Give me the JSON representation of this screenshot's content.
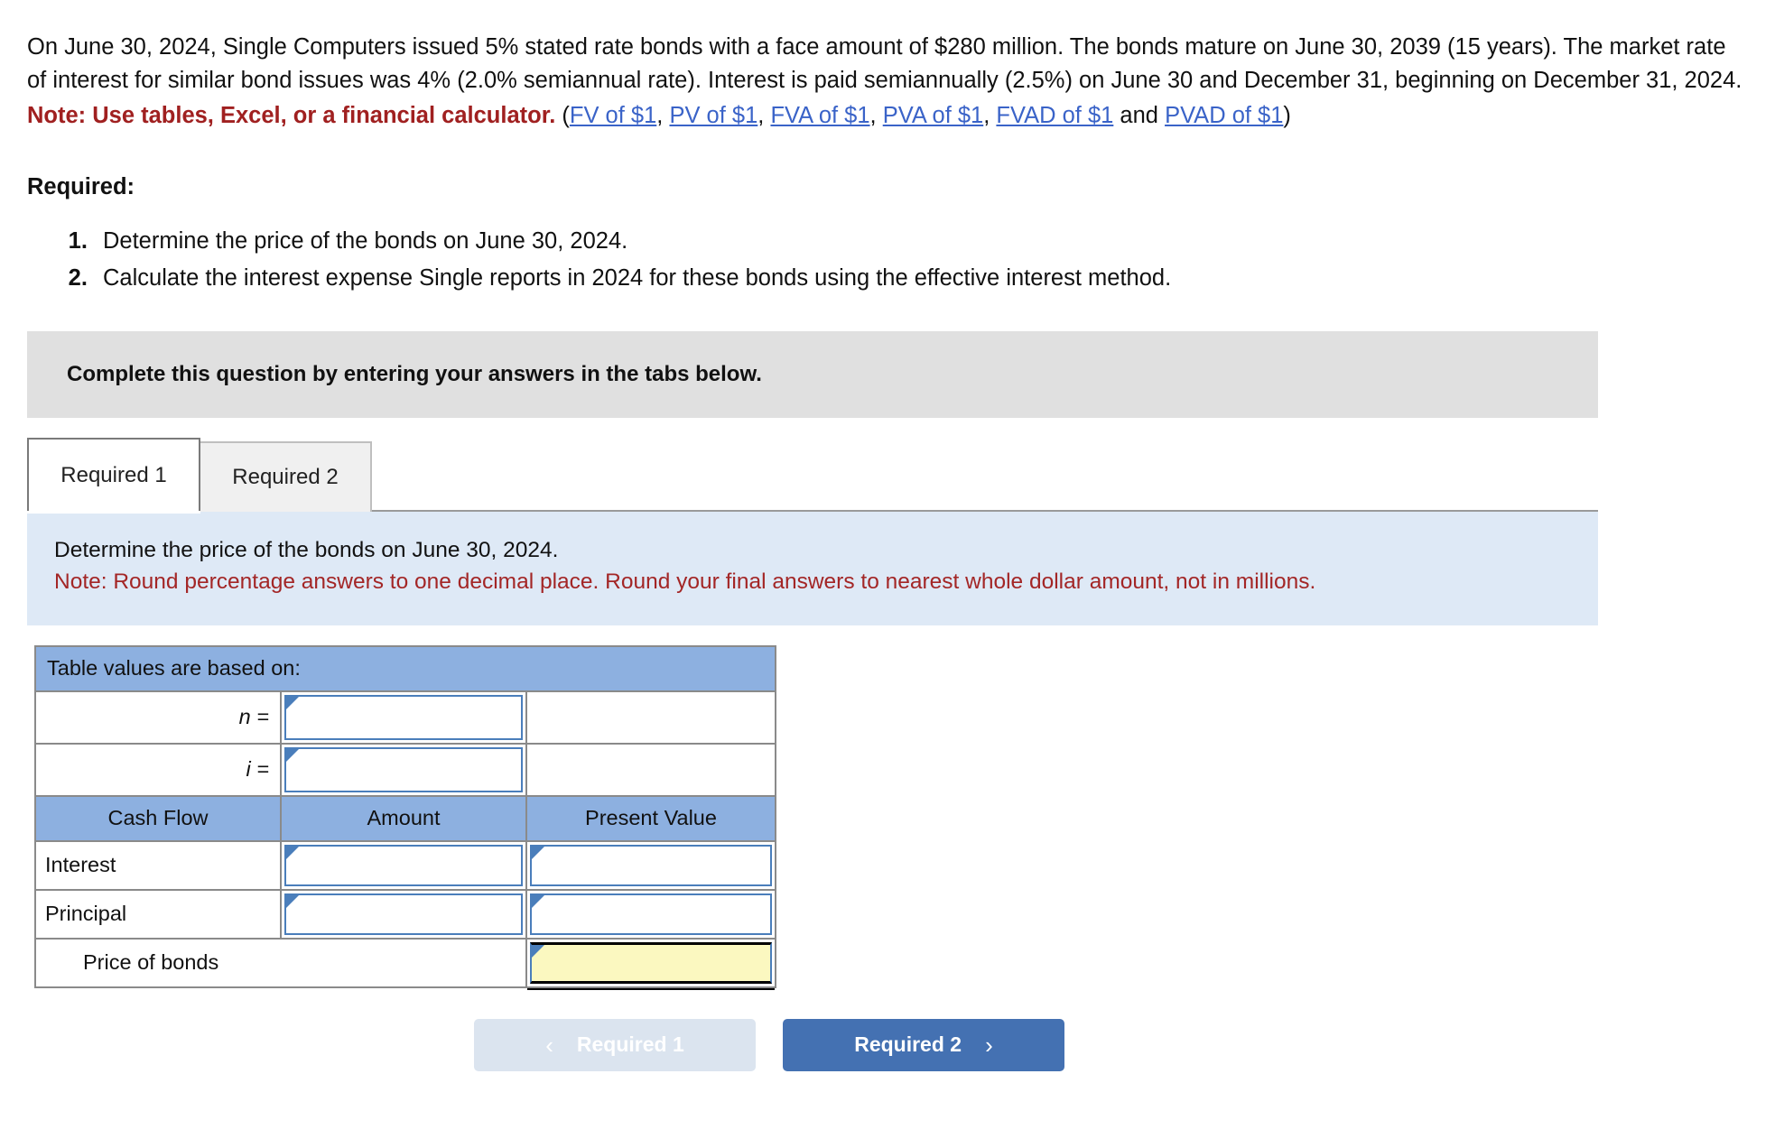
{
  "problem": {
    "paragraph": "On June 30, 2024, Single Computers issued 5% stated rate bonds with a face amount of $280 million. The bonds mature on June 30, 2039 (15 years). The market rate of interest for similar bond issues was 4% (2.0% semiannual rate). Interest is paid semiannually (2.5%) on June 30 and December 31, beginning on December 31, 2024.",
    "note_label": "Note: Use tables, Excel, or a financial calculator.",
    "paren_open": " (",
    "paren_close": ")",
    "and_word": " and ",
    "sep": ", ",
    "links": [
      {
        "label": "FV of $1"
      },
      {
        "label": "PV of $1"
      },
      {
        "label": "FVA of $1"
      },
      {
        "label": "PVA of $1"
      },
      {
        "label": "FVAD of $1"
      },
      {
        "label": "PVAD of $1"
      }
    ]
  },
  "required": {
    "heading": "Required:",
    "items": [
      "Determine the price of the bonds on June 30, 2024.",
      "Calculate the interest expense Single reports in 2024 for these bonds using the effective interest method."
    ]
  },
  "banner": {
    "text": "Complete this question by entering your answers in the tabs below."
  },
  "tabs": [
    {
      "label": "Required 1",
      "state": "active"
    },
    {
      "label": "Required 2",
      "state": "inactive"
    }
  ],
  "instruction": {
    "line1": "Determine the price of the bonds on June 30, 2024.",
    "note": "Note: Round percentage answers to one decimal place. Round your final answers to nearest whole dollar amount, not in millions."
  },
  "answer_table": {
    "band_title": "Table values are based on:",
    "assumptions": [
      {
        "label": "n =",
        "value": ""
      },
      {
        "label": "i =",
        "value": ""
      }
    ],
    "headers": [
      "Cash Flow",
      "Amount",
      "Present Value"
    ],
    "rows": [
      {
        "label": "Interest",
        "amount": "",
        "present_value": ""
      },
      {
        "label": "Principal",
        "amount": "",
        "present_value": ""
      }
    ],
    "total_row": {
      "label": "Price of bonds",
      "amount": "",
      "present_value": ""
    }
  },
  "nav": {
    "prev_label": "Required 1",
    "next_label": "Required 2",
    "prev_icon": "chevron-left-icon",
    "next_icon": "chevron-right-icon",
    "prev_glyph": "‹",
    "next_glyph": "›"
  },
  "colors": {
    "table_header_blue": "#8db0e0",
    "instruction_blue": "#dee9f6",
    "banner_grey": "#e0e0e0",
    "primary_button": "#4471b2",
    "disabled_button": "#dbe4ef",
    "note_red": "#a32626",
    "link_blue": "#3a63c8",
    "total_yellow": "#fbf8c0",
    "input_border_blue": "#4a7ebb"
  }
}
